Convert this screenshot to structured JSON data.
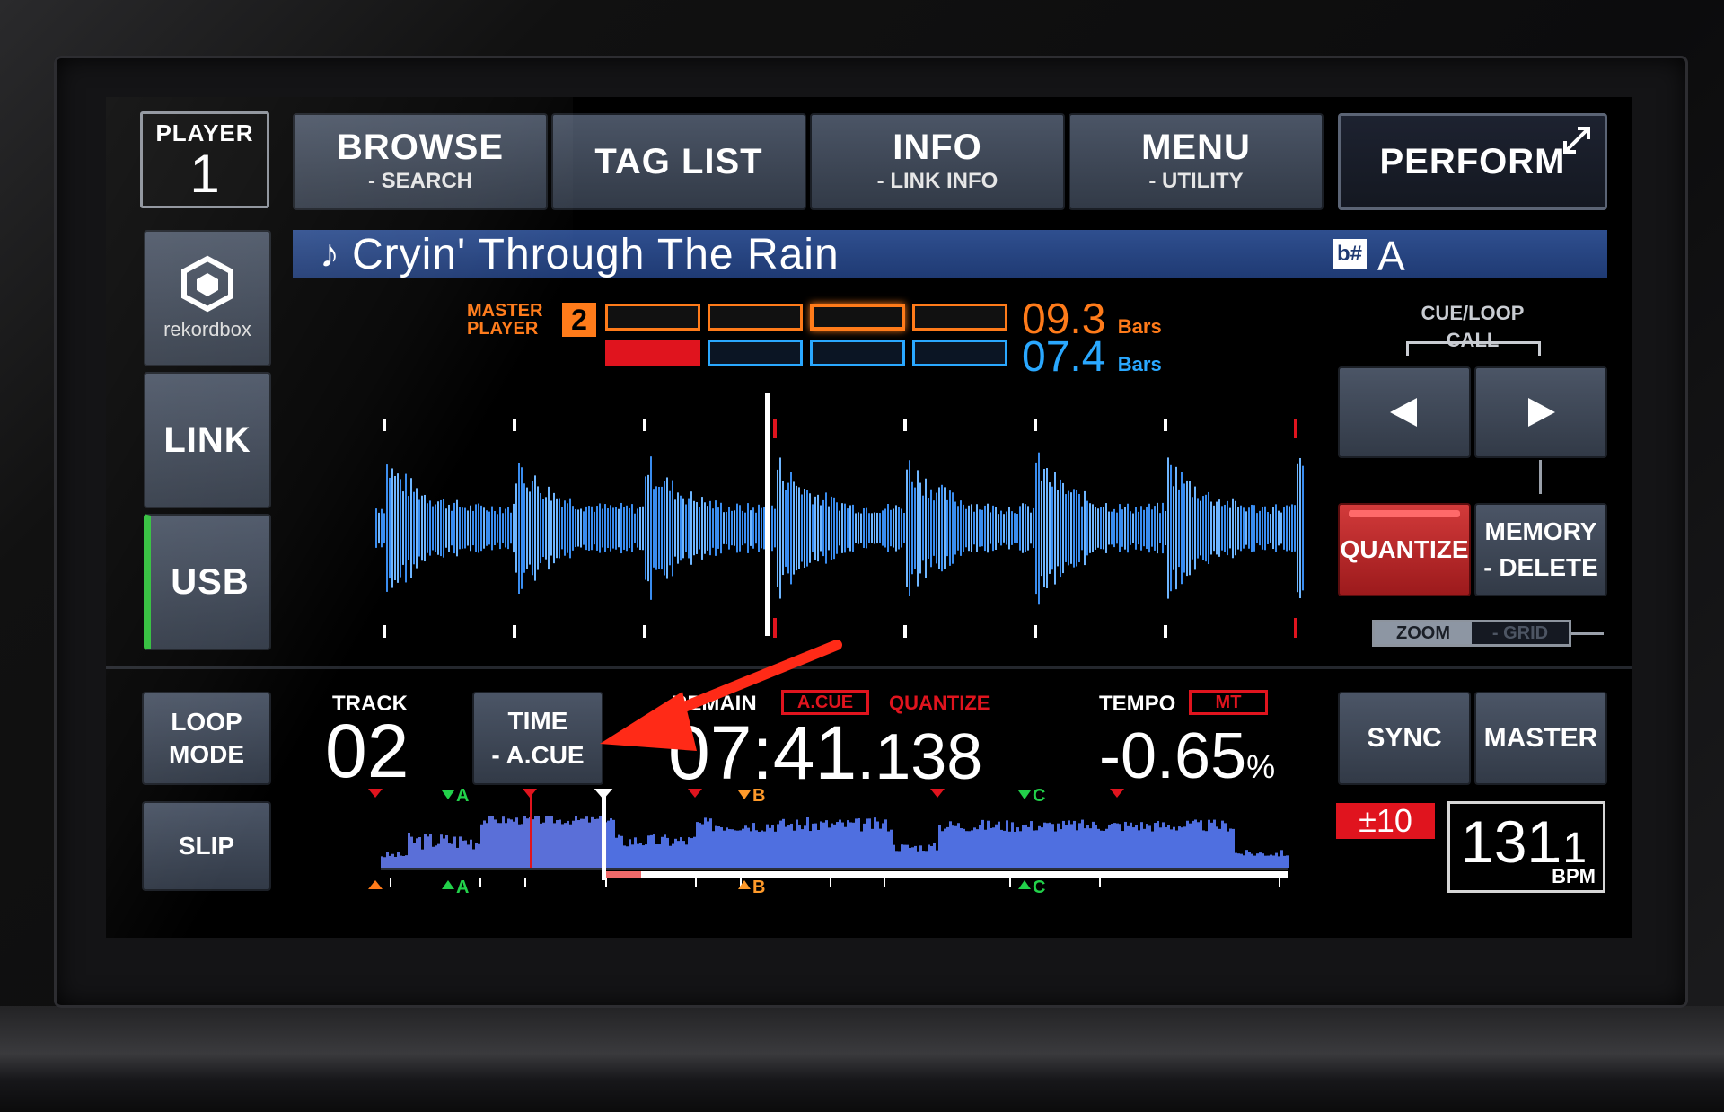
{
  "header": {
    "player_label": "PLAYER",
    "player_number": "1",
    "tabs": [
      {
        "label": "BROWSE",
        "sub": "- SEARCH"
      },
      {
        "label": "TAG LIST",
        "sub": ""
      },
      {
        "label": "INFO",
        "sub": "- LINK INFO"
      },
      {
        "label": "MENU",
        "sub": "- UTILITY"
      }
    ],
    "perform_label": "PERFORM"
  },
  "sidebar": {
    "rekordbox_label": "rekordbox",
    "link_label": "LINK",
    "usb_label": "USB"
  },
  "track": {
    "title": "Cryin' Through The Rain",
    "key": "A"
  },
  "master_player": {
    "label_line1": "MASTER",
    "label_line2": "PLAYER",
    "number": "2",
    "bars_top": "09.3",
    "bars_bottom": "07.4",
    "bars_unit": "Bars"
  },
  "cue_loop": {
    "line1": "CUE/LOOP",
    "line2": "CALL"
  },
  "right_panel": {
    "quantize_label": "QUANTIZE",
    "memory_line1": "MEMORY",
    "memory_line2": "- DELETE",
    "zoom_label": "ZOOM",
    "grid_label": "- GRID",
    "sync_label": "SYNC",
    "master_label": "MASTER",
    "tempo_range": "±10",
    "bpm_value": "131",
    "bpm_decimal": ".1",
    "bpm_unit": "BPM"
  },
  "bottom": {
    "loop_mode_line1": "LOOP",
    "loop_mode_line2": "MODE",
    "slip_label": "SLIP",
    "track_label": "TRACK",
    "track_number": "02",
    "time_line1": "TIME",
    "time_line2": "- A.CUE",
    "remain_label": "REMAIN",
    "acue_badge": "A.CUE",
    "quantize_label": "QUANTIZE",
    "time_main": "07:41",
    "time_fraction": ".138",
    "tempo_label": "TEMPO",
    "mt_badge": "MT",
    "tempo_value": "-0.65",
    "tempo_unit": "%",
    "marker_a": "A",
    "marker_b": "B",
    "marker_c": "C"
  },
  "colors": {
    "accent_orange": "#ff7b1a",
    "accent_blue": "#2aa8ff",
    "quantize_red": "#c8282a",
    "waveform_blue": "#3a8df0",
    "cue_green": "#22d14a",
    "annotation_arrow": "#ff2a17"
  }
}
